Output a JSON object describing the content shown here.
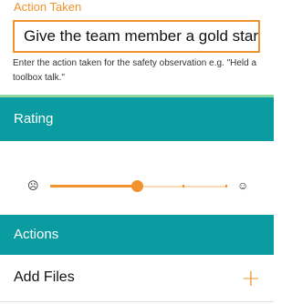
{
  "action_taken": {
    "label": "Action Taken",
    "value": "Give the team member a gold star",
    "helper": "Enter the action taken for the safety observation e.g. \"Held a toolbox talk.\""
  },
  "rating": {
    "header": "Rating",
    "left_icon_glyph": "☹",
    "right_icon_glyph": "☺",
    "value_fraction": 0.49,
    "tick_fractions": [
      0.745,
      0.99
    ],
    "accent_color": "#f2922e",
    "track_color": "#fbd9b3"
  },
  "actions": {
    "header": "Actions",
    "add_files_label": "Add Files",
    "add_icon_glyph": "+"
  },
  "colors": {
    "header_bg": "#0a9ca0",
    "accent": "#f2922e",
    "divider": "#8fd8a0"
  }
}
